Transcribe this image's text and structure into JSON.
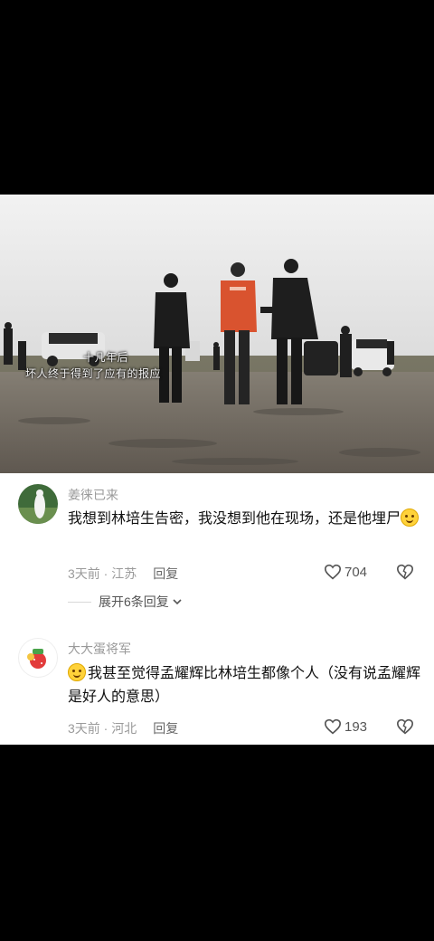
{
  "video": {
    "subtitle_line1": "十几年后",
    "subtitle_line2": "坏人终于得到了应有的报应"
  },
  "comments": [
    {
      "username": "姜徕已来",
      "text_before": "我想到林培生告密，我没想到他在现场，还是他埋尸",
      "text_after": "",
      "emoji_position": "end",
      "time": "3天前",
      "location": "江苏",
      "reply_label": "回复",
      "likes": "704"
    },
    {
      "username": "大大蛋将军",
      "text_before": "",
      "text_after": "我甚至觉得孟耀辉比林培生都像个人（没有说孟耀辉是好人的意思）",
      "emoji_position": "start",
      "time": "3天前",
      "location": "河北",
      "reply_label": "回复",
      "likes": "193"
    }
  ],
  "expand_replies": "展开6条回复",
  "icons": {
    "like": "heart-outline-icon",
    "dislike": "broken-heart-icon",
    "expand": "chevron-down-icon",
    "emoji": "smile-emoji-icon"
  }
}
